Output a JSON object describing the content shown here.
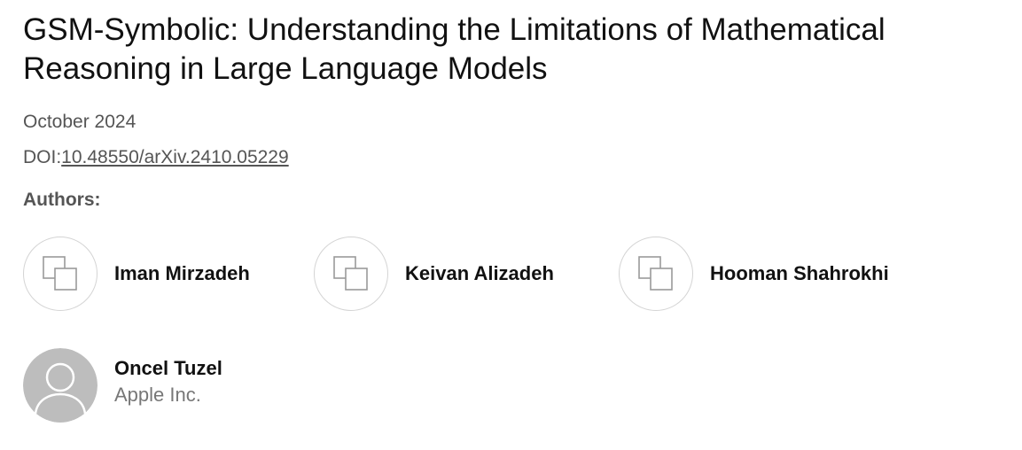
{
  "paper": {
    "title": "GSM-Symbolic: Understanding the Limitations of Mathematical Reasoning in Large Language Models",
    "date": "October 2024",
    "doi_prefix": "DOI:",
    "doi_link": "10.48550/arXiv.2410.05229"
  },
  "authors_label": "Authors:",
  "authors": [
    {
      "name": "Iman Mirzadeh",
      "icon": "profile-placeholder-icon"
    },
    {
      "name": "Keivan Alizadeh",
      "icon": "profile-placeholder-icon"
    },
    {
      "name": "Hooman Shahrokhi",
      "icon": "profile-placeholder-icon"
    },
    {
      "name": "Oncel Tuzel",
      "affiliation": "Apple Inc.",
      "icon": "default-user-avatar-icon"
    }
  ],
  "colors": {
    "title": "#111111",
    "meta_text": "#555555",
    "affiliation": "#777777",
    "avatar_border": "#d4d4d4",
    "avatar_gray": "#bdbdbd"
  }
}
